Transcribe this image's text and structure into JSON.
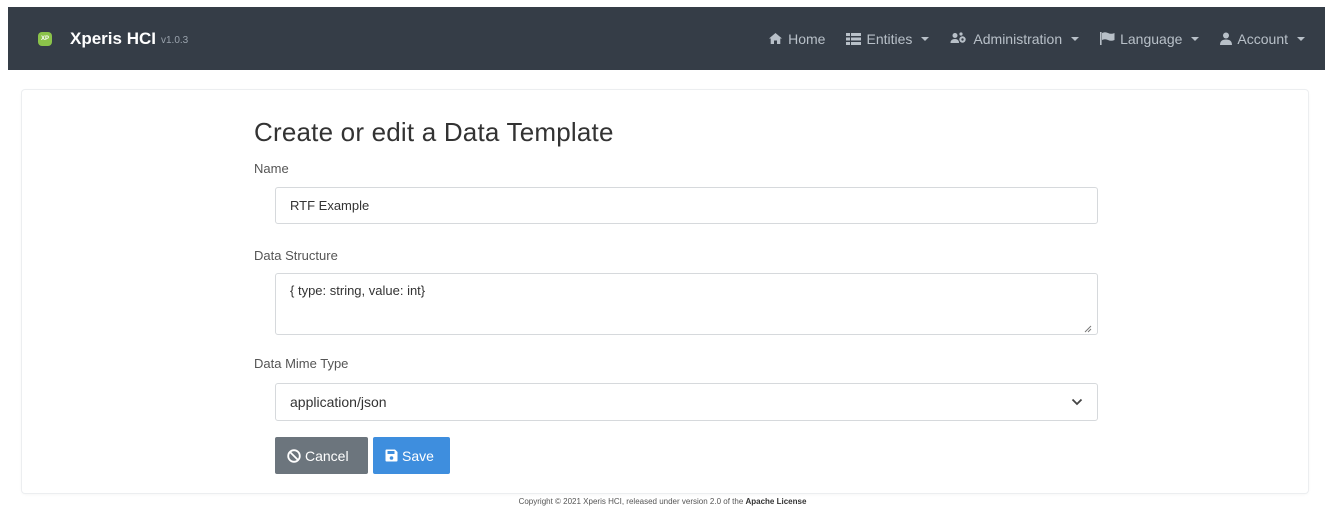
{
  "navbar": {
    "brand_logo": "XP",
    "brand_title": "Xperis HCI",
    "brand_version": "v1.0.3",
    "items": [
      {
        "label": "Home",
        "icon": "home-icon",
        "dropdown": false
      },
      {
        "label": "Entities",
        "icon": "list-icon",
        "dropdown": true
      },
      {
        "label": "Administration",
        "icon": "users-cog-icon",
        "dropdown": true
      },
      {
        "label": "Language",
        "icon": "flag-icon",
        "dropdown": true
      },
      {
        "label": "Account",
        "icon": "user-icon",
        "dropdown": true
      }
    ]
  },
  "form": {
    "title": "Create or edit a Data Template",
    "name_label": "Name",
    "name_value": "RTF Example",
    "structure_label": "Data Structure",
    "structure_value": "{ type: string, value: int}",
    "mime_label": "Data Mime Type",
    "mime_value": "application/json",
    "cancel_label": "Cancel",
    "save_label": "Save"
  },
  "footer": {
    "text": "Copyright © 2021 Xperis HCI, released under version 2.0 of the ",
    "link": "Apache License"
  },
  "colors": {
    "navbar": "#353d47",
    "cancel": "#6c757d",
    "save": "#3e8ede",
    "logo": "#8bc34a"
  }
}
